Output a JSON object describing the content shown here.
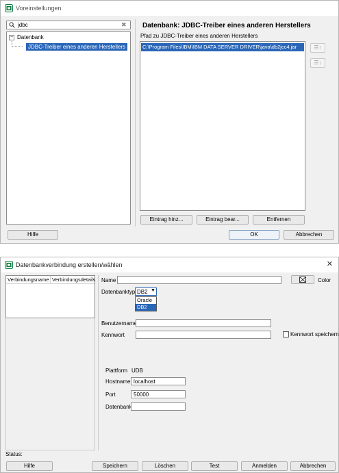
{
  "prefs": {
    "title": "Voreinstellungen",
    "search_value": "jdbc",
    "tree": {
      "root": "Datenbank",
      "child": "JDBC-Treiber eines anderen Herstellers"
    },
    "heading": "Datenbank: JDBC-Treiber eines anderen Herstellers",
    "path_label": "Pfad zu JDBC-Treiber eines anderen Herstellers",
    "path_entry": "C:\\Program Files\\IBM\\IBM DATA SERVER DRIVER\\java\\db2jcc4.jar",
    "btn_add": "Eintrag hinz...",
    "btn_edit": "Eintrag bear...",
    "btn_remove": "Entfernen",
    "btn_help": "Hilfe",
    "btn_ok": "OK",
    "btn_cancel": "Abbrechen",
    "move_up_symbol": "☰↑",
    "move_down_symbol": "☰↓"
  },
  "conn": {
    "title": "Datenbankverbindung erstellen/wählen",
    "col_name": "Verbindungsname",
    "col_details": "Verbindungsdetails",
    "name_label": "Name",
    "color_label": "Color",
    "dbtype_label": "Datenbanktyp",
    "dbtype_value": "DB2",
    "dbtype_options": [
      "Oracle",
      "DB2"
    ],
    "user_label": "Benutzername",
    "password_label": "Kennwort",
    "save_password_label": "Kennwort speichern",
    "platform_label": "Plattform",
    "platform_value": "UDB",
    "host_label": "Hostname",
    "host_value": "localhost",
    "port_label": "Port",
    "port_value": "50000",
    "database_label": "Datenbank",
    "status_label": "Status:",
    "btn_help": "Hilfe",
    "btn_save": "Speichern",
    "btn_delete": "Löschen",
    "btn_test": "Test",
    "btn_login": "Anmelden",
    "btn_cancel": "Abbrechen"
  },
  "colors": {
    "selection": "#2a66b8",
    "accent": "#0b7a3e"
  }
}
